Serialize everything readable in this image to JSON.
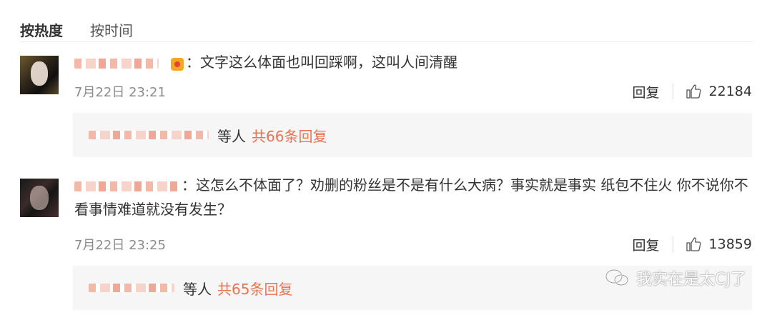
{
  "sort_tabs": [
    {
      "label": "按热度",
      "active": true
    },
    {
      "label": "按时间",
      "active": false
    }
  ],
  "comments": [
    {
      "separator": "：",
      "text": "文字这么体面也叫回踩啊，这叫人间清醒",
      "time": "7月22日 23:21",
      "reply_label": "回复",
      "likes": "22184",
      "reply_summary": {
        "etc": "等人",
        "count": "共66条回复"
      }
    },
    {
      "separator": "：",
      "text": "这怎么不体面了？劝删的粉丝是不是有什么大病？事实就是事实 纸包不住火 你不说你不看事情难道就没有发生？",
      "time": "7月22日 23:25",
      "reply_label": "回复",
      "likes": "13859",
      "reply_summary": {
        "etc": "等人",
        "count": "共65条回复"
      }
    }
  ],
  "watermark": {
    "text": "我实在是太CJ了",
    "icon": "wechat-icon"
  },
  "colors": {
    "accent": "#eb7350",
    "muted": "#8c8c8c",
    "reply_bg": "#f6f6f6"
  }
}
